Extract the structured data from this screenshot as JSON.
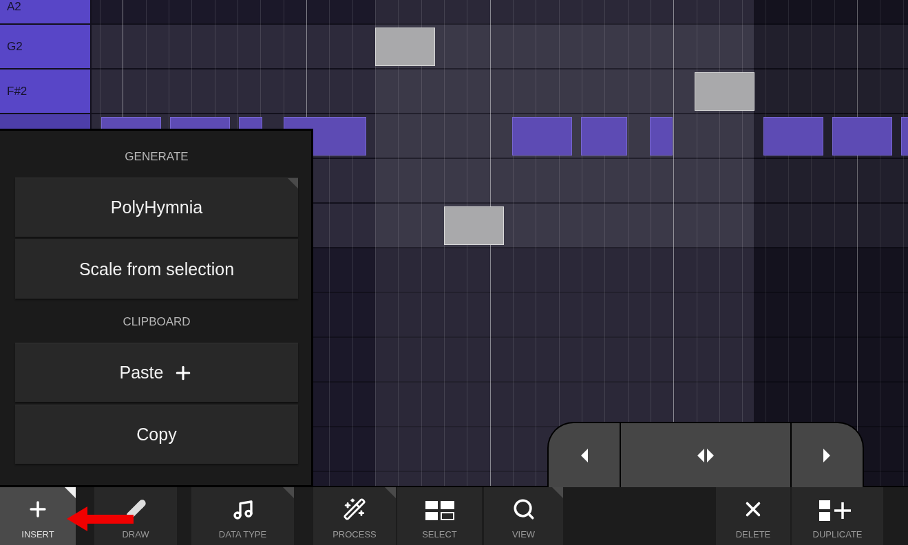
{
  "keys": [
    {
      "label": "A2"
    },
    {
      "label": "G2"
    },
    {
      "label": "F#2"
    }
  ],
  "notes": [
    {
      "selected": false
    },
    {
      "selected": false
    },
    {
      "selected": false
    },
    {
      "selected": false
    },
    {
      "selected": false
    },
    {
      "selected": false
    },
    {
      "selected": false
    },
    {
      "selected": false
    },
    {
      "selected": false
    },
    {
      "selected": false
    },
    {
      "selected": true
    },
    {
      "selected": true
    },
    {
      "selected": true
    }
  ],
  "popup_menu": {
    "sections": [
      {
        "heading": "GENERATE",
        "items": [
          {
            "label": "PolyHymnia",
            "has_submenu": true,
            "kind": "plain"
          },
          {
            "label": "Scale from selection",
            "has_submenu": false,
            "kind": "plain"
          }
        ]
      },
      {
        "heading": "CLIPBOARD",
        "items": [
          {
            "label": "Paste",
            "has_submenu": false,
            "kind": "add"
          },
          {
            "label": "Copy",
            "has_submenu": false,
            "kind": "plain"
          }
        ]
      }
    ]
  },
  "toolbar": [
    {
      "label": "INSERT",
      "selected": true,
      "has_menu": true
    },
    {
      "label": "DRAW",
      "selected": false,
      "has_menu": false
    },
    {
      "label": "DATA TYPE",
      "selected": false,
      "has_menu": true
    },
    {
      "label": "PROCESS",
      "selected": false,
      "has_menu": true
    },
    {
      "label": "SELECT",
      "selected": false,
      "has_menu": false
    },
    {
      "label": "VIEW",
      "selected": false,
      "has_menu": true
    },
    {
      "label": "DELETE",
      "selected": false,
      "has_menu": false
    },
    {
      "label": "DUPLICATE",
      "selected": false,
      "has_menu": false
    }
  ]
}
